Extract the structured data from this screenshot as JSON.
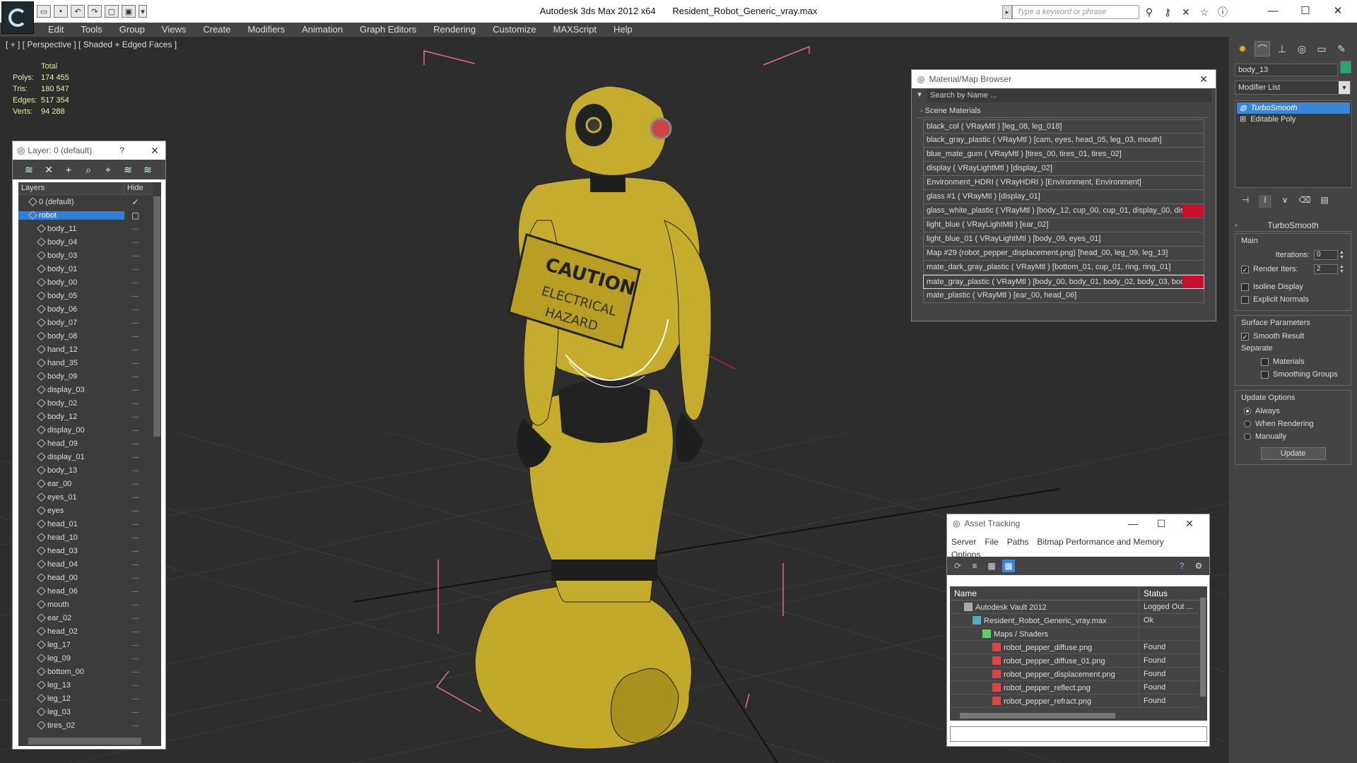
{
  "window": {
    "app_name": "Autodesk 3ds Max  2012 x64",
    "file_name": "Resident_Robot_Generic_vray.max",
    "search_placeholder": "Type a keyword or phrase"
  },
  "menu": [
    "Edit",
    "Tools",
    "Group",
    "Views",
    "Create",
    "Modifiers",
    "Animation",
    "Graph Editors",
    "Rendering",
    "Customize",
    "MAXScript",
    "Help"
  ],
  "viewport": {
    "label": "[ + ] [ Perspective ] [ Shaded + Edged Faces ]",
    "stats_header": "Total",
    "stats": [
      {
        "k": "Polys:",
        "v": "174 455"
      },
      {
        "k": "Tris:",
        "v": "180 547"
      },
      {
        "k": "Edges:",
        "v": "517 354"
      },
      {
        "k": "Verts:",
        "v": "94 288"
      }
    ]
  },
  "layer_panel": {
    "title": "Layer: 0 (default)",
    "help": "?",
    "col_layers": "Layers",
    "col_hide": "Hide",
    "hide_mark": "-----",
    "rows": [
      {
        "name": "0 (default)",
        "level": 1,
        "sel": false
      },
      {
        "name": "robot",
        "level": 1,
        "sel": true
      },
      {
        "name": "body_11",
        "level": 2
      },
      {
        "name": "body_04",
        "level": 2
      },
      {
        "name": "body_03",
        "level": 2
      },
      {
        "name": "body_01",
        "level": 2
      },
      {
        "name": "body_00",
        "level": 2
      },
      {
        "name": "body_05",
        "level": 2
      },
      {
        "name": "body_06",
        "level": 2
      },
      {
        "name": "body_07",
        "level": 2
      },
      {
        "name": "body_08",
        "level": 2
      },
      {
        "name": "hand_12",
        "level": 2
      },
      {
        "name": "hand_35",
        "level": 2
      },
      {
        "name": "body_09",
        "level": 2
      },
      {
        "name": "display_03",
        "level": 2
      },
      {
        "name": "body_02",
        "level": 2
      },
      {
        "name": "body_12",
        "level": 2
      },
      {
        "name": "display_00",
        "level": 2
      },
      {
        "name": "head_09",
        "level": 2
      },
      {
        "name": "display_01",
        "level": 2
      },
      {
        "name": "body_13",
        "level": 2
      },
      {
        "name": "ear_00",
        "level": 2
      },
      {
        "name": "eyes_01",
        "level": 2
      },
      {
        "name": "eyes",
        "level": 2
      },
      {
        "name": "head_01",
        "level": 2
      },
      {
        "name": "head_10",
        "level": 2
      },
      {
        "name": "head_03",
        "level": 2
      },
      {
        "name": "head_04",
        "level": 2
      },
      {
        "name": "head_00",
        "level": 2
      },
      {
        "name": "head_06",
        "level": 2
      },
      {
        "name": "mouth",
        "level": 2
      },
      {
        "name": "ear_02",
        "level": 2
      },
      {
        "name": "head_02",
        "level": 2
      },
      {
        "name": "leg_17",
        "level": 2
      },
      {
        "name": "leg_09",
        "level": 2
      },
      {
        "name": "bottom_00",
        "level": 2
      },
      {
        "name": "leg_13",
        "level": 2
      },
      {
        "name": "leg_12",
        "level": 2
      },
      {
        "name": "leg_03",
        "level": 2
      },
      {
        "name": "tires_02",
        "level": 2
      }
    ]
  },
  "material_browser": {
    "title": "Material/Map Browser",
    "search_placeholder": "Search by Name ...",
    "group": "Scene Materials",
    "items": [
      {
        "text": "black_col  ( VRayMtl ) [leg_08, leg_018]"
      },
      {
        "text": "black_gray_plastic  ( VRayMtl ) [cam, eyes, head_05, leg_03, mouth]"
      },
      {
        "text": "blue_mate_gum  ( VRayMtl ) [tires_00, tires_01, tires_02]"
      },
      {
        "text": "display  ( VRayLightMtl ) [display_02]"
      },
      {
        "text": "Environment_HDRI  ( VRayHDRI ) [Environment, Environment]"
      },
      {
        "text": "glass #1  ( VRayMtl ) [display_01]"
      },
      {
        "text": "glass_white_plastic  ( VRayMtl ) [body_12, cup_00, cup_01, display_00, dis...",
        "flag": true
      },
      {
        "text": "light_blue  ( VRayLightMtl ) [ear_02]"
      },
      {
        "text": "light_blue_01  ( VRayLightMtl ) [body_09, eyes_01]"
      },
      {
        "text": "Map #29 (robot_pepper_displacement.png)  [head_00, leg_09, leg_13]"
      },
      {
        "text": "mate_dark_gray_plastic  ( VRayMtl ) [bottom_01, cup_01, ring, ring_01]"
      },
      {
        "text": "mate_gray_plastic  ( VRayMtl ) [body_00, body_01, body_02, body_03, bod...",
        "flag": true,
        "sel": true
      },
      {
        "text": "mate_plastic  ( VRayMtl ) [ear_00, head_06]"
      }
    ]
  },
  "command_panel": {
    "object_name": "body_13",
    "modifier_list": "Modifier List",
    "stack": [
      {
        "label": "TurboSmooth",
        "sel": true
      },
      {
        "label": "Editable Poly",
        "sel": false
      }
    ],
    "rollout_title": "TurboSmooth",
    "main_label": "Main",
    "iterations_label": "Iterations:",
    "iterations_value": "0",
    "render_iters_label": "Render Iters:",
    "render_iters_value": "2",
    "isoline_label": "Isoline Display",
    "explicit_label": "Explicit Normals",
    "surface_label": "Surface Parameters",
    "smooth_label": "Smooth Result",
    "separate_label": "Separate",
    "materials_label": "Materials",
    "smoothing_label": "Smoothing Groups",
    "update_options_label": "Update Options",
    "always_label": "Always",
    "when_rendering_label": "When Rendering",
    "manually_label": "Manually",
    "update_button": "Update",
    "colors": {
      "object_color": "#22aa66"
    }
  },
  "asset_tracking": {
    "title": "Asset Tracking",
    "menu": [
      "Server",
      "File",
      "Paths",
      "Bitmap Performance and Memory",
      "Options"
    ],
    "col_name": "Name",
    "col_status": "Status",
    "rows": [
      {
        "name": "Autodesk Vault 2012",
        "status": "Logged Out ...",
        "indent": 20,
        "icon": "vault-icon"
      },
      {
        "name": "Resident_Robot_Generic_vray.max",
        "status": "Ok",
        "indent": 32,
        "icon": "max-file-icon"
      },
      {
        "name": "Maps / Shaders",
        "status": "",
        "indent": 46,
        "icon": "maps-icon"
      },
      {
        "name": "robot_pepper_diffuse.png",
        "status": "Found",
        "indent": 60,
        "icon": "png-icon"
      },
      {
        "name": "robot_pepper_diffuse_01.png",
        "status": "Found",
        "indent": 60,
        "icon": "png-icon"
      },
      {
        "name": "robot_pepper_displacement.png",
        "status": "Found",
        "indent": 60,
        "icon": "png-icon"
      },
      {
        "name": "robot_pepper_reflect.png",
        "status": "Found",
        "indent": 60,
        "icon": "png-icon"
      },
      {
        "name": "robot_pepper_refract.png",
        "status": "Found",
        "indent": 60,
        "icon": "png-icon"
      }
    ]
  }
}
